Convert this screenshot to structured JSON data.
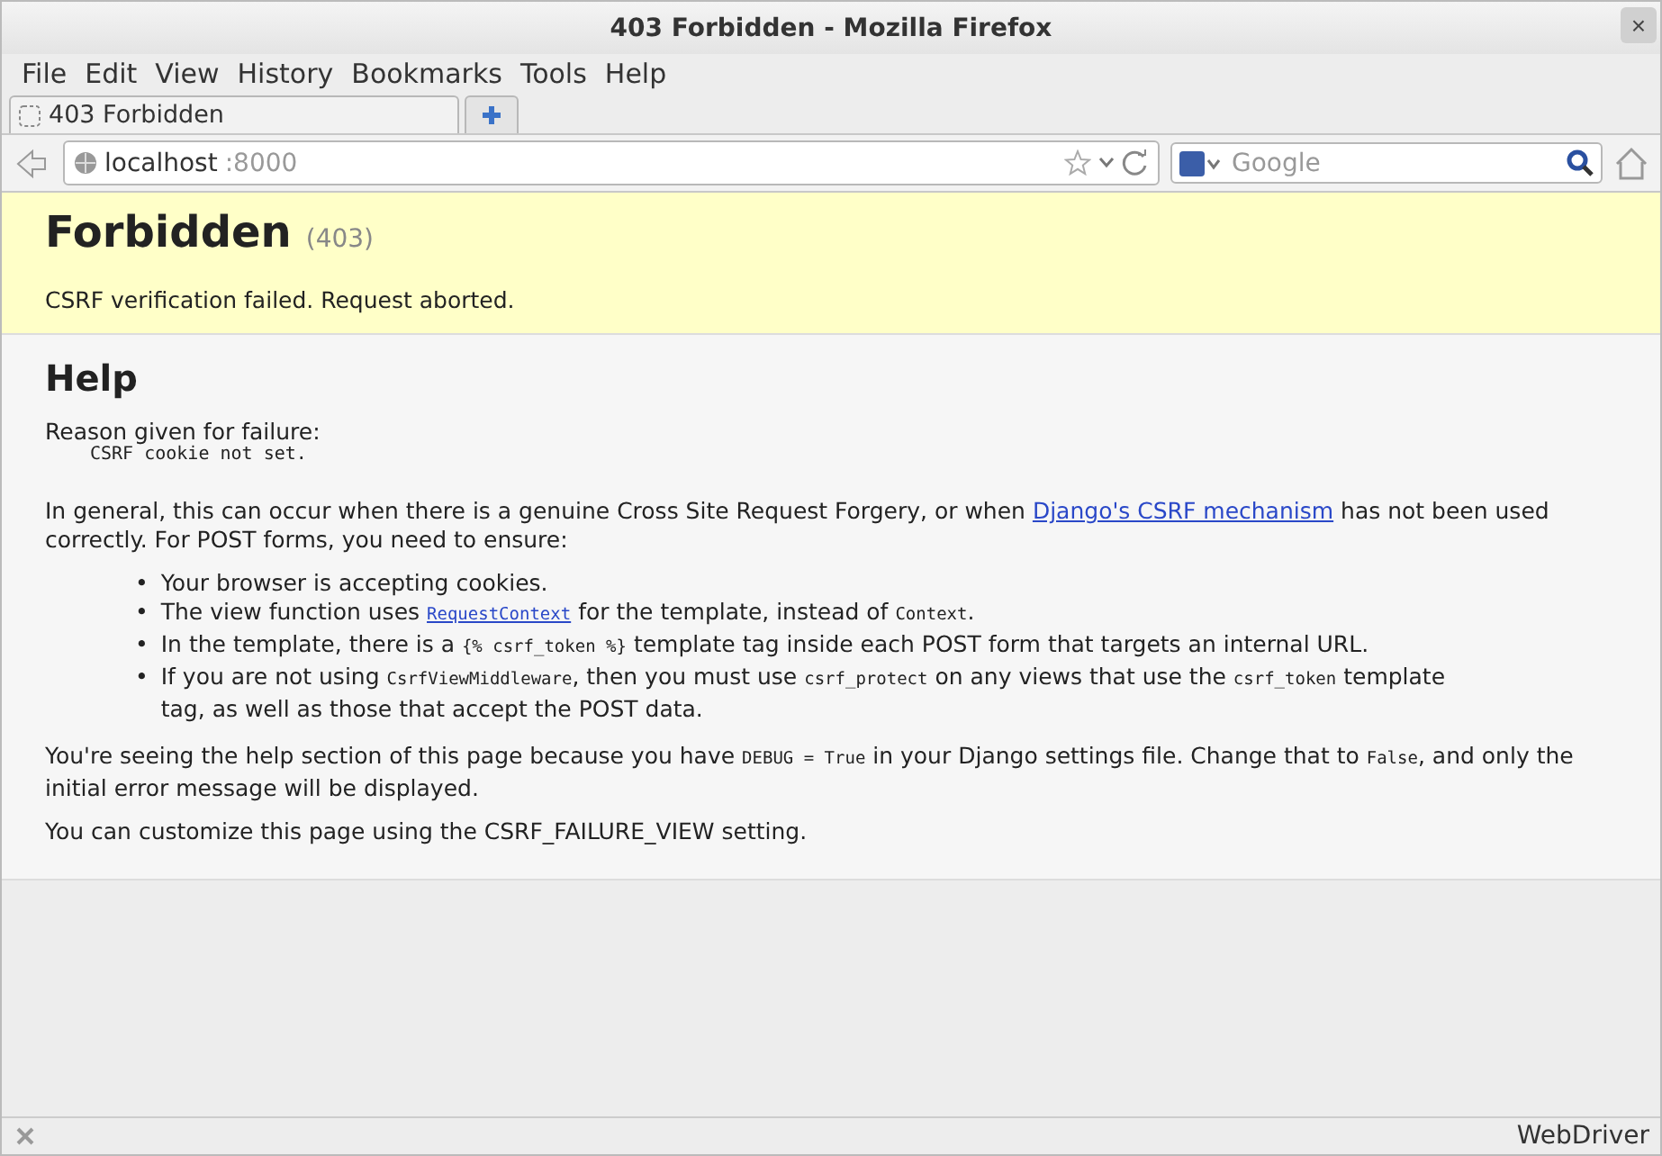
{
  "window": {
    "title": "403 Forbidden - Mozilla Firefox",
    "close": "×"
  },
  "menu": [
    "File",
    "Edit",
    "View",
    "History",
    "Bookmarks",
    "Tools",
    "Help"
  ],
  "tabs": [
    {
      "label": "403 Forbidden",
      "selected": true
    }
  ],
  "navbar": {
    "url_host": "localhost",
    "url_port": ":8000",
    "search_placeholder": "Google"
  },
  "page": {
    "title": "Forbidden",
    "code": "(403)",
    "summary": "CSRF verification failed. Request aborted.",
    "help_title": "Help",
    "reason_label": "Reason given for failure:",
    "reason": "CSRF cookie not set.",
    "intro": [
      {
        "kind": "text",
        "text": "In general, this can occur when there is a genuine Cross Site Request Forgery, or when "
      },
      {
        "kind": "link",
        "text": "Django's CSRF mechanism"
      },
      {
        "kind": "text",
        "text": " has not been used correctly. For POST forms, you need to ensure:"
      }
    ],
    "bullets": [
      {
        "marker": "•",
        "parts": [
          {
            "kind": "text",
            "text": "Your browser is accepting cookies."
          }
        ]
      },
      {
        "marker": "•",
        "parts": [
          {
            "kind": "text",
            "text": "The view function uses "
          },
          {
            "kind": "link",
            "text": "RequestContext"
          },
          {
            "kind": "text",
            "text": " for the template, instead of "
          },
          {
            "kind": "code",
            "text": "Context"
          },
          {
            "kind": "text",
            "text": "."
          }
        ]
      },
      {
        "marker": "•",
        "parts": [
          {
            "kind": "text",
            "text": "In the template, there is a "
          },
          {
            "kind": "code",
            "text": "{% csrf_token %}"
          },
          {
            "kind": "text",
            "text": " template tag inside each POST form that targets an internal URL."
          }
        ]
      },
      {
        "marker": "•",
        "parts": [
          {
            "kind": "text",
            "text": "If you are not using "
          },
          {
            "kind": "code",
            "text": "CsrfViewMiddleware"
          },
          {
            "kind": "text",
            "text": ", then you must use "
          },
          {
            "kind": "code",
            "text": "csrf_protect"
          },
          {
            "kind": "text",
            "text": " on any views that use the "
          },
          {
            "kind": "code",
            "text": "csrf_token"
          },
          {
            "kind": "text",
            "text": " template tag, as well as those that accept the POST data."
          }
        ]
      }
    ],
    "debug_note": [
      {
        "kind": "text",
        "text": "You're seeing the help section of this page because you have "
      },
      {
        "kind": "code",
        "text": "DEBUG = True"
      },
      {
        "kind": "text",
        "text": " in your Django settings file. Change that to "
      },
      {
        "kind": "code",
        "text": "False"
      },
      {
        "kind": "text",
        "text": ", and only the initial error message will be displayed."
      }
    ],
    "customize": "You can customize this page using the CSRF_FAILURE_VIEW setting."
  },
  "status_bar": {
    "text": "WebDriver"
  }
}
